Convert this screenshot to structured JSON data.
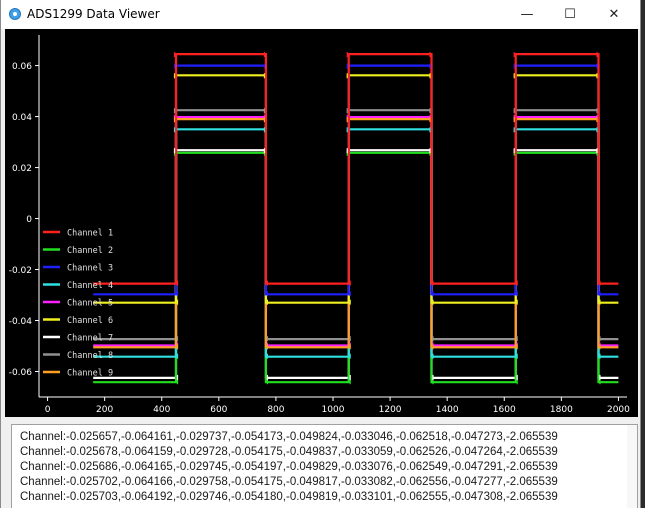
{
  "window": {
    "title": "ADS1299 Data Viewer",
    "minimize_glyph": "—",
    "maximize_glyph": "☐",
    "close_glyph": "✕"
  },
  "chart_data": {
    "type": "line",
    "title": "",
    "xlabel": "",
    "ylabel": "",
    "xlim": [
      -30,
      2030
    ],
    "ylim": [
      -0.07,
      0.072
    ],
    "x_ticks": [
      0,
      200,
      400,
      600,
      800,
      1000,
      1200,
      1400,
      1600,
      1800,
      2000
    ],
    "y_ticks": [
      0.06,
      0.04,
      0.02,
      0,
      -0.02,
      -0.04,
      -0.06
    ],
    "y_tick_labels": [
      "0.06",
      "0.04",
      "0.02",
      "0",
      "-0.02",
      "-0.04",
      "-0.06"
    ],
    "grid": false,
    "background": "#000000",
    "legend_placement": "bottom-left",
    "square_wave": {
      "visible_x_start": 160,
      "high_segments": [
        [
          450,
          765
        ],
        [
          1055,
          1345
        ],
        [
          1640,
          1930
        ]
      ],
      "low_segments": [
        [
          160,
          450
        ],
        [
          765,
          1055
        ],
        [
          1345,
          1640
        ],
        [
          1930,
          2000
        ]
      ]
    },
    "series": [
      {
        "name": "Channel 1",
        "color": "#ff2020",
        "high": 0.0645,
        "low": -0.0255
      },
      {
        "name": "Channel 2",
        "color": "#20e020",
        "high": 0.0258,
        "low": -0.0642
      },
      {
        "name": "Channel 3",
        "color": "#2020ff",
        "high": 0.06,
        "low": -0.0297
      },
      {
        "name": "Channel 4",
        "color": "#30e0e0",
        "high": 0.035,
        "low": -0.0542
      },
      {
        "name": "Channel 5",
        "color": "#ff20ff",
        "high": 0.0398,
        "low": -0.0498
      },
      {
        "name": "Channel 6",
        "color": "#f0f020",
        "high": 0.0562,
        "low": -0.033
      },
      {
        "name": "Channel 7",
        "color": "#ffffff",
        "high": 0.0268,
        "low": -0.0625
      },
      {
        "name": "Channel 8",
        "color": "#909090",
        "high": 0.0425,
        "low": -0.0473
      },
      {
        "name": "Channel 9",
        "color": "#ffa020",
        "high": 0.039,
        "low": -0.0505
      }
    ]
  },
  "log": {
    "lines": [
      "Channel:-0.025657,-0.064161,-0.029737,-0.054173,-0.049824,-0.033046,-0.062518,-0.047273,-2.065539",
      "Channel:-0.025678,-0.064159,-0.029728,-0.054175,-0.049837,-0.033059,-0.062526,-0.047264,-2.065539",
      "Channel:-0.025686,-0.064165,-0.029745,-0.054197,-0.049829,-0.033076,-0.062549,-0.047291,-2.065539",
      "Channel:-0.025702,-0.064166,-0.029758,-0.054175,-0.049817,-0.033082,-0.062556,-0.047277,-2.065539",
      "Channel:-0.025703,-0.064192,-0.029746,-0.054180,-0.049819,-0.033101,-0.062555,-0.047308,-2.065539"
    ]
  }
}
